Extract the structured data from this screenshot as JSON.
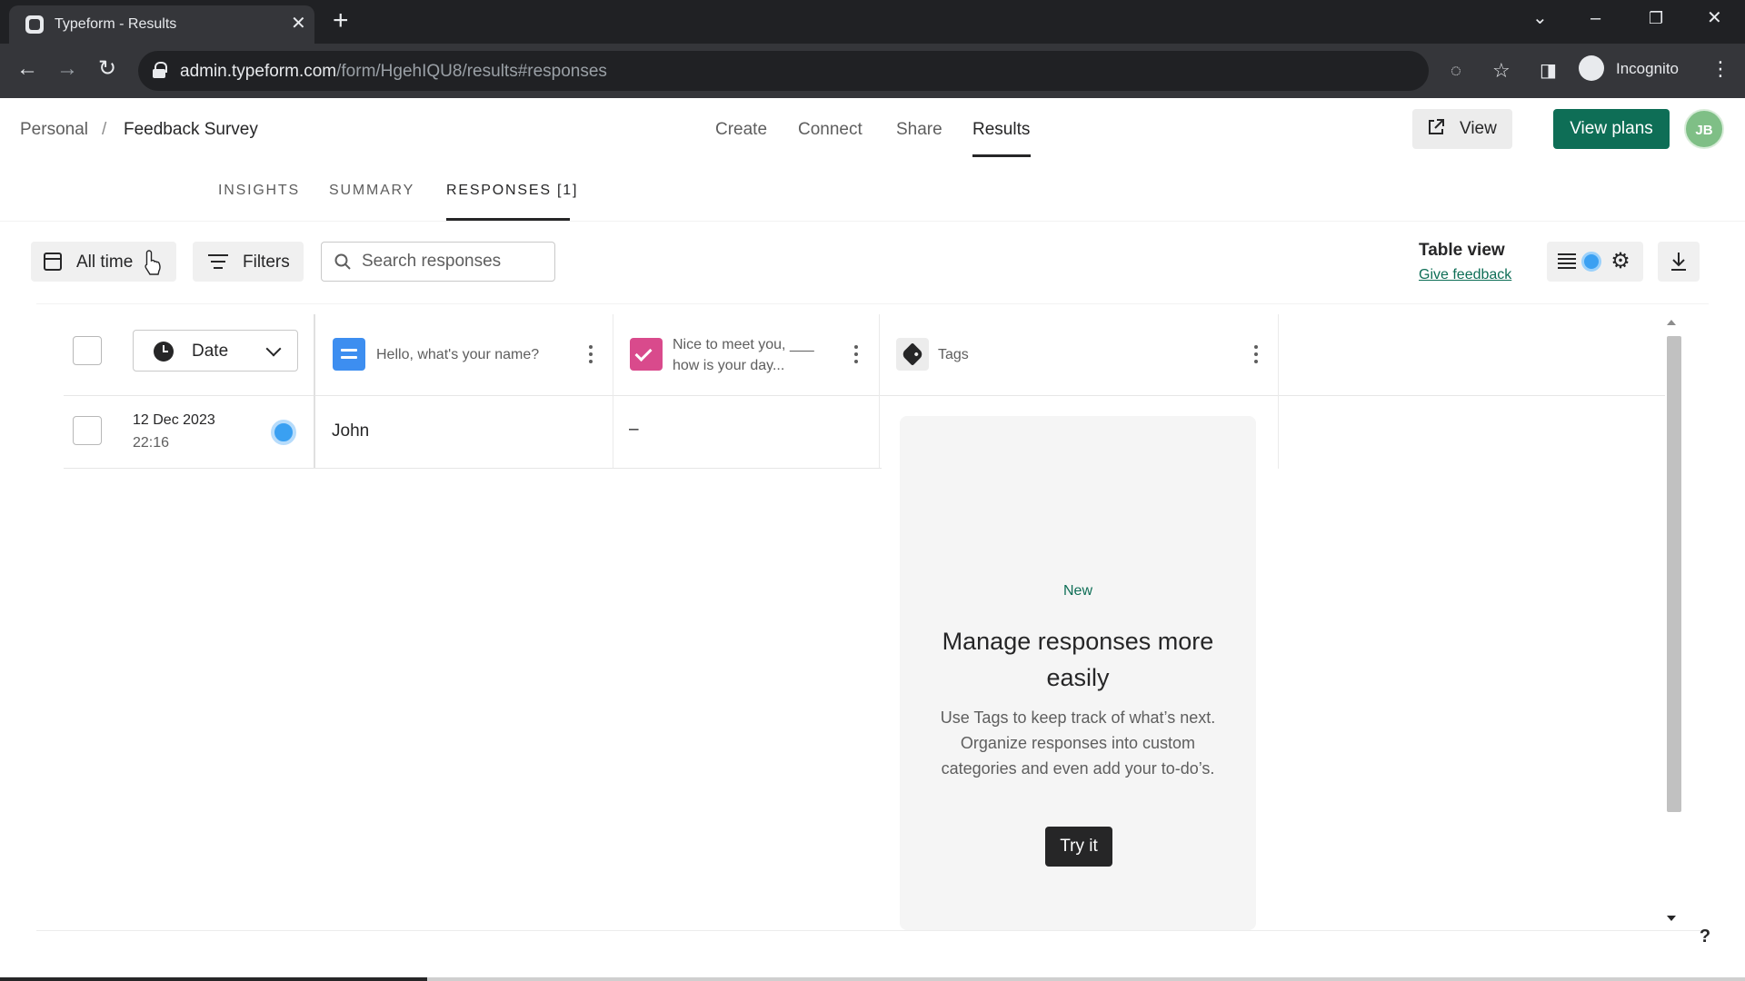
{
  "browser": {
    "tab_title": "Typeform - Results",
    "url_host": "admin.typeform.com",
    "url_path": "/form/HgehIQU8/results#responses",
    "profile_label": "Incognito"
  },
  "header": {
    "breadcrumb": [
      "Personal",
      "/",
      "Feedback Survey"
    ],
    "nav": [
      {
        "label": "Create"
      },
      {
        "label": "Connect"
      },
      {
        "label": "Share"
      },
      {
        "label": "Results",
        "active": true
      }
    ],
    "view_label": "View",
    "plans_label": "View plans",
    "avatar_initials": "JB"
  },
  "subtabs": [
    {
      "label": "INSIGHTS"
    },
    {
      "label": "SUMMARY"
    },
    {
      "label": "RESPONSES [1]",
      "active": true
    }
  ],
  "toolbar": {
    "date_filter_label": "All time",
    "filters_label": "Filters",
    "search_placeholder": "Search responses",
    "table_view_title": "Table view",
    "feedback_link": "Give feedback"
  },
  "table": {
    "date_column_label": "Date",
    "columns": [
      {
        "title": "Hello, what's your name?",
        "type": "short-text",
        "color": "#3d8ef0"
      },
      {
        "title_line1": "Nice to meet you, ___",
        "title_line2": "how is your day...",
        "type": "multiple-choice",
        "color": "#d94a8c"
      },
      {
        "title": "Tags",
        "type": "tags"
      }
    ],
    "rows": [
      {
        "date": "12 Dec 2023",
        "time": "22:16",
        "name": "John",
        "day": "–"
      }
    ]
  },
  "promo": {
    "badge": "New",
    "title": "Manage responses more easily",
    "body": "Use Tags to keep track of what’s next. Organize responses into custom categories and even add your to-do’s.",
    "cta": "Try it"
  },
  "colors": {
    "brand_green": "#0e6e56",
    "status_blue": "#3aa0f2"
  },
  "help_label": "?"
}
